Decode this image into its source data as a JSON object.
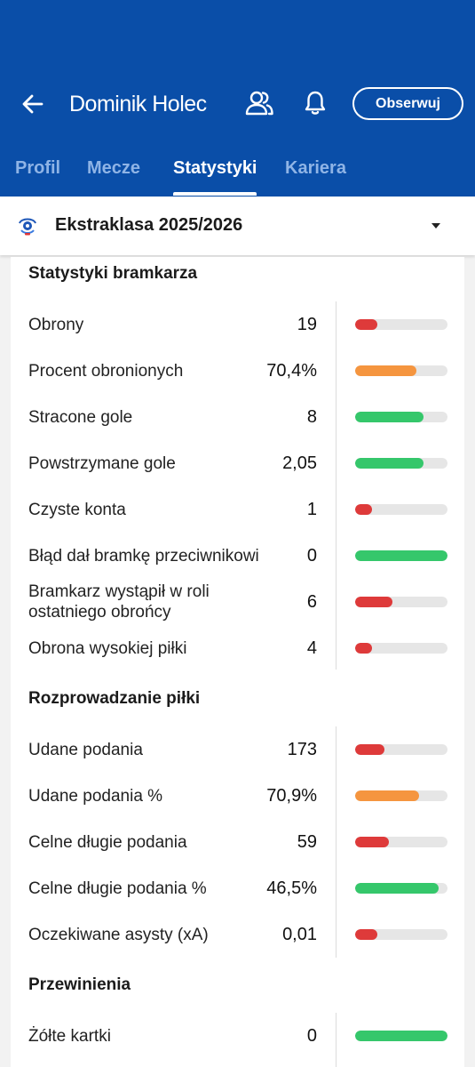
{
  "header": {
    "title": "Dominik Holec",
    "follow_label": "Obserwuj",
    "back_icon": "arrow-left-icon",
    "people_icon": "people-icon",
    "bell_icon": "bell-icon",
    "background": "#0a4ea8"
  },
  "tabs": [
    {
      "label": "Profil",
      "active": false
    },
    {
      "label": "Mecze",
      "active": false
    },
    {
      "label": "Statystyki",
      "active": true
    },
    {
      "label": "Kariera",
      "active": false
    }
  ],
  "league": {
    "name": "Ekstraklasa 2025/2026"
  },
  "colors": {
    "red": "#de3a3a",
    "orange": "#f5953f",
    "green": "#35c76b",
    "track": "#e6e6e6"
  },
  "sections": [
    {
      "title": "Statystyki bramkarza",
      "rows": [
        {
          "label": "Obrony",
          "value": "19",
          "level": 0.24,
          "color": "red"
        },
        {
          "label": "Procent obronionych",
          "value": "70,4%",
          "level": 0.66,
          "color": "orange"
        },
        {
          "label": "Stracone gole",
          "value": "8",
          "level": 0.74,
          "color": "green"
        },
        {
          "label": "Powstrzymane gole",
          "value": "2,05",
          "level": 0.74,
          "color": "green"
        },
        {
          "label": "Czyste konta",
          "value": "1",
          "level": 0.18,
          "color": "red"
        },
        {
          "label": "Błąd dał bramkę przeciwnikowi",
          "value": "0",
          "level": 1.0,
          "color": "green"
        },
        {
          "label": "Bramkarz wystąpił w roli ostatniego obrońcy",
          "value": "6",
          "level": 0.4,
          "color": "red"
        },
        {
          "label": "Obrona wysokiej piłki",
          "value": "4",
          "level": 0.18,
          "color": "red"
        }
      ]
    },
    {
      "title": "Rozprowadzanie piłki",
      "rows": [
        {
          "label": "Udane podania",
          "value": "173",
          "level": 0.32,
          "color": "red"
        },
        {
          "label": "Udane podania %",
          "value": "70,9%",
          "level": 0.69,
          "color": "orange"
        },
        {
          "label": "Celne długie podania",
          "value": "59",
          "level": 0.37,
          "color": "red"
        },
        {
          "label": "Celne długie podania %",
          "value": "46,5%",
          "level": 0.9,
          "color": "green"
        },
        {
          "label": "Oczekiwane asysty (xA)",
          "value": "0,01",
          "level": 0.24,
          "color": "red"
        }
      ]
    },
    {
      "title": "Przewinienia",
      "rows": [
        {
          "label": "Żółte kartki",
          "value": "0",
          "level": 1.0,
          "color": "green"
        }
      ]
    }
  ]
}
